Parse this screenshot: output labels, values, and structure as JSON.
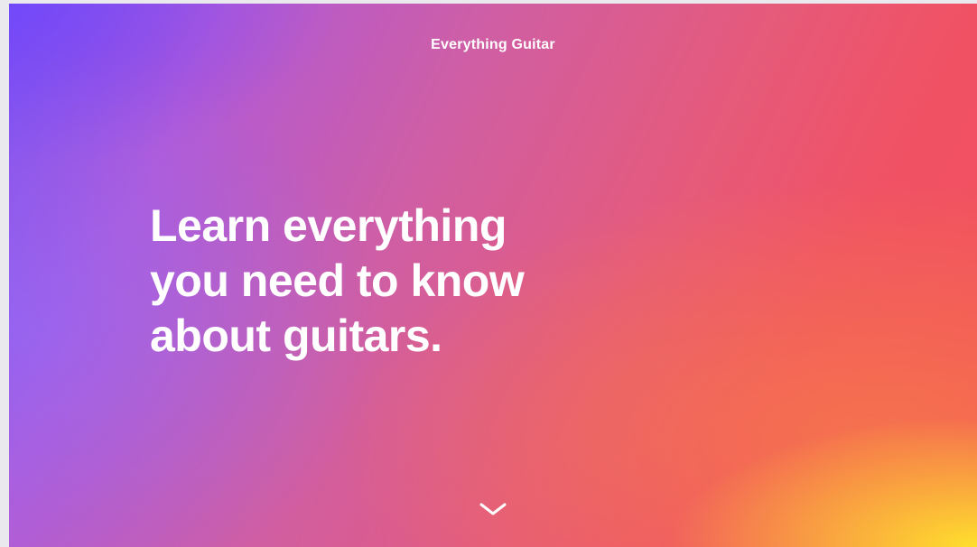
{
  "header": {
    "site_title": "Everything Guitar"
  },
  "hero": {
    "headline_lines": [
      "Learn everything",
      "you need to know",
      "about guitars."
    ]
  },
  "icons": {
    "scroll_down": "chevron-down-icon"
  },
  "colors": {
    "gradient_top_left": "#7A4EF0",
    "gradient_mid": "#D85F92",
    "gradient_right": "#F34F5A",
    "gradient_bottom_right": "#FFE22C",
    "text": "#FFFFFF"
  }
}
